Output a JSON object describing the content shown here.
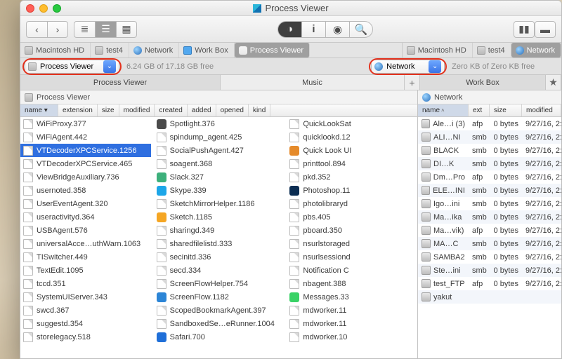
{
  "title": "Process Viewer",
  "toolbar": {
    "nav_back": "‹",
    "nav_fwd": "›"
  },
  "path_left": [
    {
      "label": "Macintosh HD",
      "icon": "hd"
    },
    {
      "label": "test4",
      "icon": "hd"
    },
    {
      "label": "Network",
      "icon": "globe"
    },
    {
      "label": "Work Box",
      "icon": "box"
    },
    {
      "label": "Process Viewer",
      "icon": "bar",
      "active": true
    }
  ],
  "path_right": [
    {
      "label": "Macintosh HD",
      "icon": "hd"
    },
    {
      "label": "test4",
      "icon": "hd"
    },
    {
      "label": "Network",
      "icon": "globe",
      "active": true
    }
  ],
  "drop_left": {
    "label": "Process Viewer",
    "free": "6.24 GB of 17.18 GB free"
  },
  "drop_right": {
    "label": "Network",
    "free": "Zero KB of Zero KB free"
  },
  "tabs_left": [
    "Process Viewer",
    "Music"
  ],
  "tabs_right": [
    "Work Box"
  ],
  "panehdr_left": "Process Viewer",
  "panehdr_right": "Network",
  "cols_left": [
    "name",
    "extension",
    "size",
    "modified",
    "created",
    "added",
    "opened",
    "kind"
  ],
  "list_left_col1": [
    "WiFiProxy.377",
    "WiFiAgent.442",
    "VTDecoderXPCService.1256",
    "VTDecoderXPCService.465",
    "ViewBridgeAuxiliary.736",
    "usernoted.358",
    "UserEventAgent.320",
    "useractivityd.364",
    "USBAgent.576",
    "universalAcce…uthWarn.1063",
    "TISwitcher.449",
    "TextEdit.1095",
    "tccd.351",
    "SystemUIServer.343",
    "swcd.367",
    "suggestd.354",
    "storelegacy.518"
  ],
  "list_left_col2": [
    "Spotlight.376",
    "spindump_agent.425",
    "SocialPushAgent.427",
    "soagent.368",
    "Slack.327",
    "Skype.339",
    "SketchMirrorHelper.1186",
    "Sketch.1185",
    "sharingd.349",
    "sharedfilelistd.333",
    "secinitd.336",
    "secd.334",
    "ScreenFlowHelper.754",
    "ScreenFlow.1182",
    "ScopedBookmarkAgent.397",
    "SandboxedSe…eRunner.1004",
    "Safari.700"
  ],
  "list_left_col3": [
    "QuickLookSat",
    "quicklookd.12",
    "Quick Look UI",
    "printtool.894",
    "pkd.352",
    "Photoshop.11",
    "photolibraryd",
    "pbs.405",
    "pboard.350",
    "nsurlstoraged",
    "nsurlsessiond",
    "Notification C",
    "nbagent.388",
    "Messages.33",
    "mdworker.11",
    "mdworker.11",
    "mdworker.10"
  ],
  "selected_left": "VTDecoderXPCService.1256",
  "cols_right": [
    "name",
    "ext",
    "size",
    "modified"
  ],
  "list_right": [
    {
      "n": "Ale…i (3)",
      "e": "afp",
      "s": "0 bytes",
      "m": "9/27/16, 2:"
    },
    {
      "n": "ALI…NI",
      "e": "smb",
      "s": "0 bytes",
      "m": "9/27/16, 2:"
    },
    {
      "n": "BLACK",
      "e": "smb",
      "s": "0 bytes",
      "m": "9/27/16, 2:"
    },
    {
      "n": "DI…K",
      "e": "smb",
      "s": "0 bytes",
      "m": "9/27/16, 2:"
    },
    {
      "n": "Dm…Pro",
      "e": "afp",
      "s": "0 bytes",
      "m": "9/27/16, 2:"
    },
    {
      "n": "ELE…INI",
      "e": "smb",
      "s": "0 bytes",
      "m": "9/27/16, 2:"
    },
    {
      "n": "Igo…ini",
      "e": "smb",
      "s": "0 bytes",
      "m": "9/27/16, 2:"
    },
    {
      "n": "Ma…ika",
      "e": "smb",
      "s": "0 bytes",
      "m": "9/27/16, 2:"
    },
    {
      "n": "Ma…vik)",
      "e": "afp",
      "s": "0 bytes",
      "m": "9/27/16, 2:"
    },
    {
      "n": "MA…C",
      "e": "smb",
      "s": "0 bytes",
      "m": "9/27/16, 2:"
    },
    {
      "n": "SAMBA2",
      "e": "smb",
      "s": "0 bytes",
      "m": "9/27/16, 2:"
    },
    {
      "n": "Ste…ini",
      "e": "smb",
      "s": "0 bytes",
      "m": "9/27/16, 2:"
    },
    {
      "n": "test_FTP",
      "e": "afp",
      "s": "0 bytes",
      "m": "9/27/16, 2:"
    },
    {
      "n": "yakut",
      "e": "",
      "s": "",
      "m": ""
    }
  ]
}
